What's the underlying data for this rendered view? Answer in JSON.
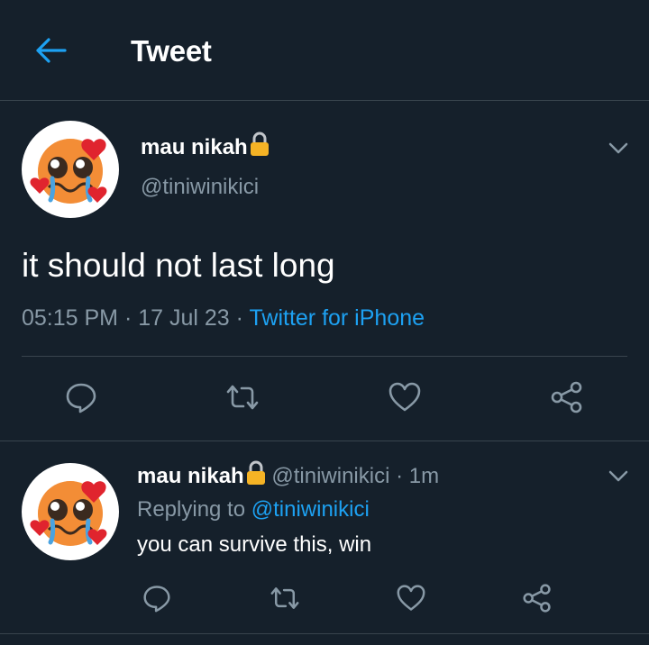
{
  "header": {
    "title": "Tweet",
    "back_icon": "back-arrow-icon"
  },
  "tweet": {
    "display_name": "mau nikah",
    "handle": "@tiniwinikici",
    "text": "it should not last long",
    "time": "05:15 PM",
    "separator1": "·",
    "date": "17 Jul 23",
    "separator2": "·",
    "source": "Twitter for iPhone"
  },
  "reply": {
    "display_name": "mau nikah",
    "handle": "@tiniwinikici",
    "separator": "·",
    "age": "1m",
    "replying_prefix": "Replying to",
    "replying_to": "@tiniwinikici",
    "text": "you can survive this, win"
  },
  "colors": {
    "background": "#15202b",
    "border": "#38444d",
    "muted": "#8899a6",
    "accent": "#1da1f2",
    "text": "#ffffff"
  },
  "icons": [
    "back-arrow-icon",
    "lock-icon",
    "chevron-down-icon",
    "reply-icon",
    "retweet-icon",
    "like-icon",
    "share-icon",
    "pleading-face-with-hearts-emoji"
  ]
}
